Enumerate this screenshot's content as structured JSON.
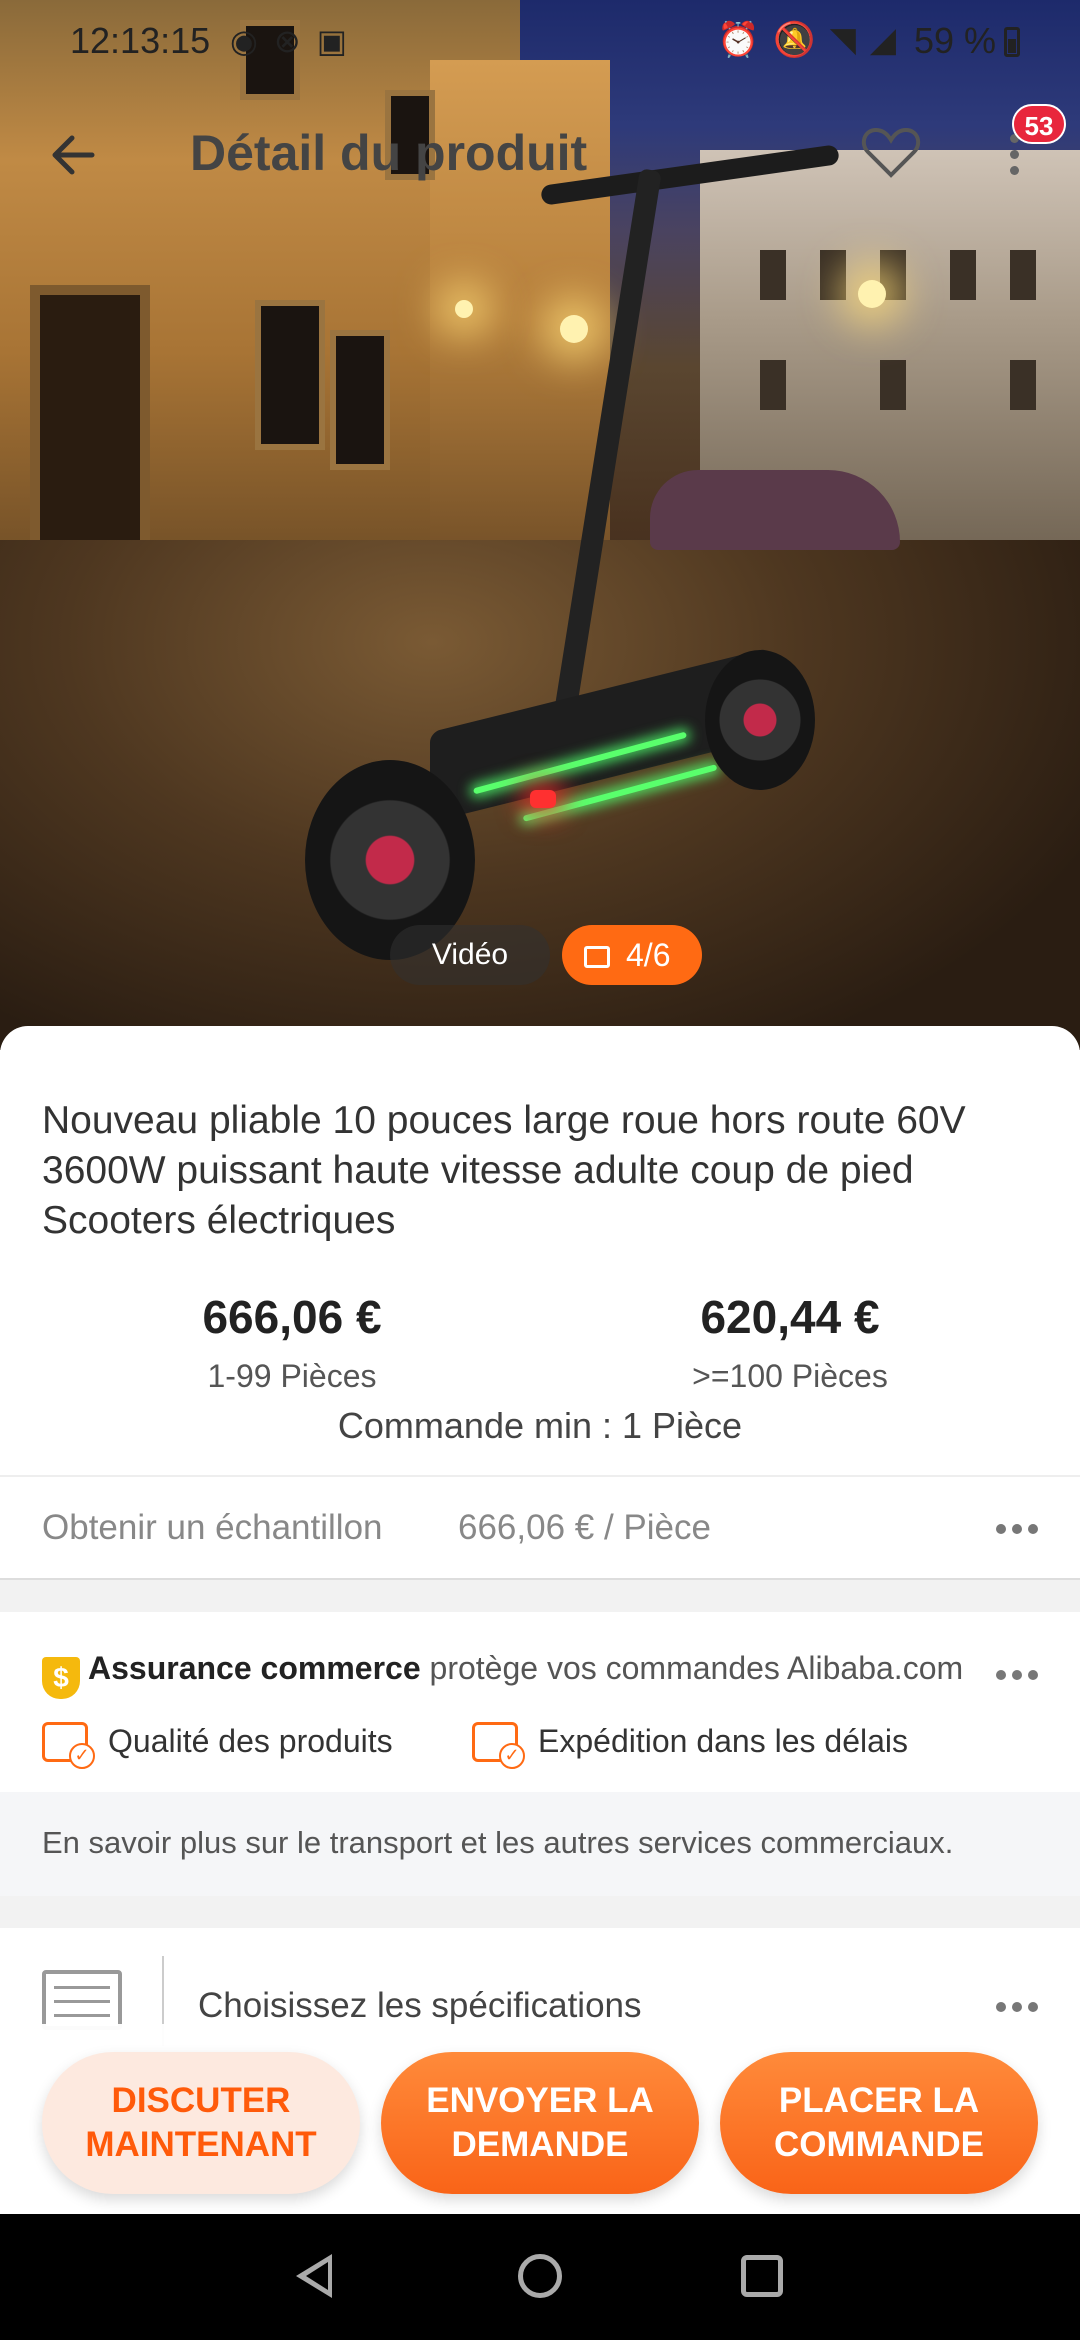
{
  "status_bar": {
    "time": "12:13:15",
    "battery": "59 %",
    "left_icons": [
      "messenger-icon",
      "notification-icon",
      "facebook-icon"
    ],
    "right_icons": [
      "alarm-icon",
      "mute-icon",
      "wifi-icon",
      "signal-icon"
    ]
  },
  "header": {
    "title": "Détail du produit",
    "cart_badge": "53"
  },
  "media": {
    "video_label": "Vidéo",
    "photo_counter": "4/6"
  },
  "product": {
    "title": "Nouveau pliable 10 pouces large roue hors route 60V 3600W puissant haute vitesse adulte coup de pied Scooters électriques",
    "prices": [
      {
        "price": "666,06 €",
        "range": "1-99 Pièces"
      },
      {
        "price": "620,44 €",
        "range": ">=100 Pièces"
      }
    ],
    "min_order": "Commande min : 1 Pièce"
  },
  "sample": {
    "label": "Obtenir un échantillon",
    "value": "666,06 € / Pièce"
  },
  "trade_assurance": {
    "shield_glyph": "$",
    "title": "Assurance commerce",
    "desc": "protège vos commandes Alibaba.com",
    "features": [
      "Qualité des produits",
      "Expédition dans les délais"
    ],
    "learn_more": "En savoir plus sur le transport et les autres services commerciaux."
  },
  "specs": {
    "label": "Choisissez les spécifications"
  },
  "actions": {
    "chat": "DISCUTER MAINTENANT",
    "inquiry": "ENVOYER LA DEMANDE",
    "order": "PLACER LA COMMANDE"
  },
  "colors": {
    "accent": "#ff6a13",
    "badge": "#e8263c",
    "trade_yellow": "#f5b90d"
  }
}
